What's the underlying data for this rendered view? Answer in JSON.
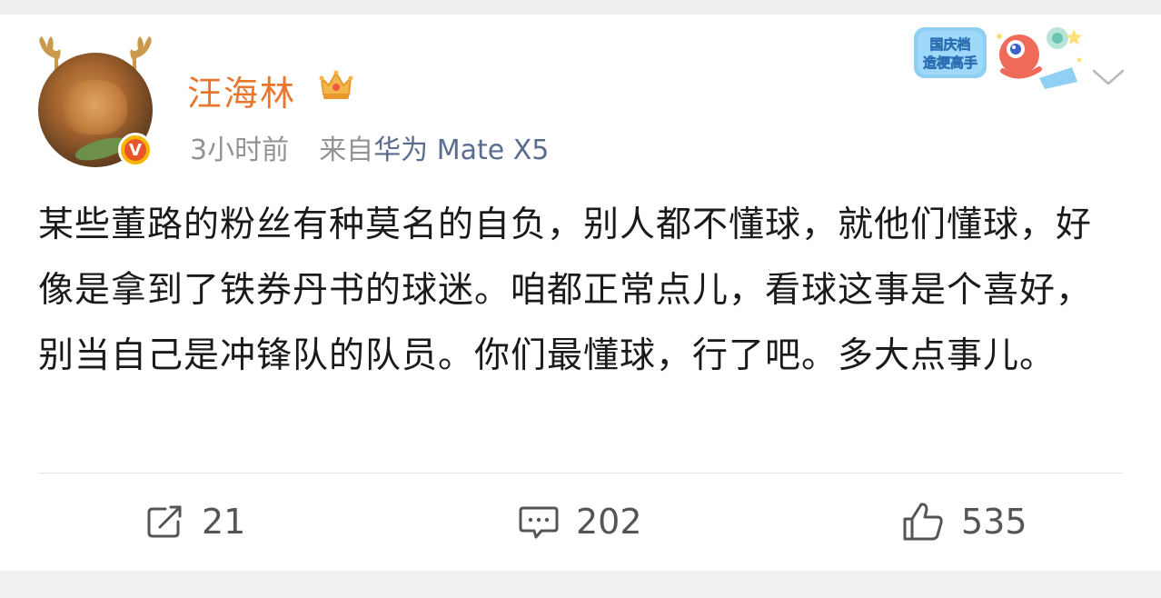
{
  "post": {
    "author": "汪海林",
    "time": "3小时前",
    "source_prefix": "来自",
    "source_device": "华为 Mate X5",
    "text": "某些董路的粉丝有种莫名的自负，别人都不懂球，就他们懂球，好像是拿到了铁券丹书的球迷。咱都正常点儿，看球这事是个喜好，别当自己是冲锋队的队员。你们最懂球，行了吧。多大点事儿。",
    "badge_letter": "V"
  },
  "promo": {
    "line1": "国庆档",
    "line2": "造梗高手"
  },
  "actions": {
    "repost_count": "21",
    "comment_count": "202",
    "like_count": "535"
  },
  "icons": {
    "repost": "edit-share-icon",
    "comment": "comment-icon",
    "like": "thumbs-up-icon",
    "chevron": "chevron-down-icon",
    "crown": "crown-icon"
  },
  "colors": {
    "author": "#e8762d",
    "meta": "#939393",
    "device": "#5b6d8f",
    "badge": "#f7b500"
  }
}
